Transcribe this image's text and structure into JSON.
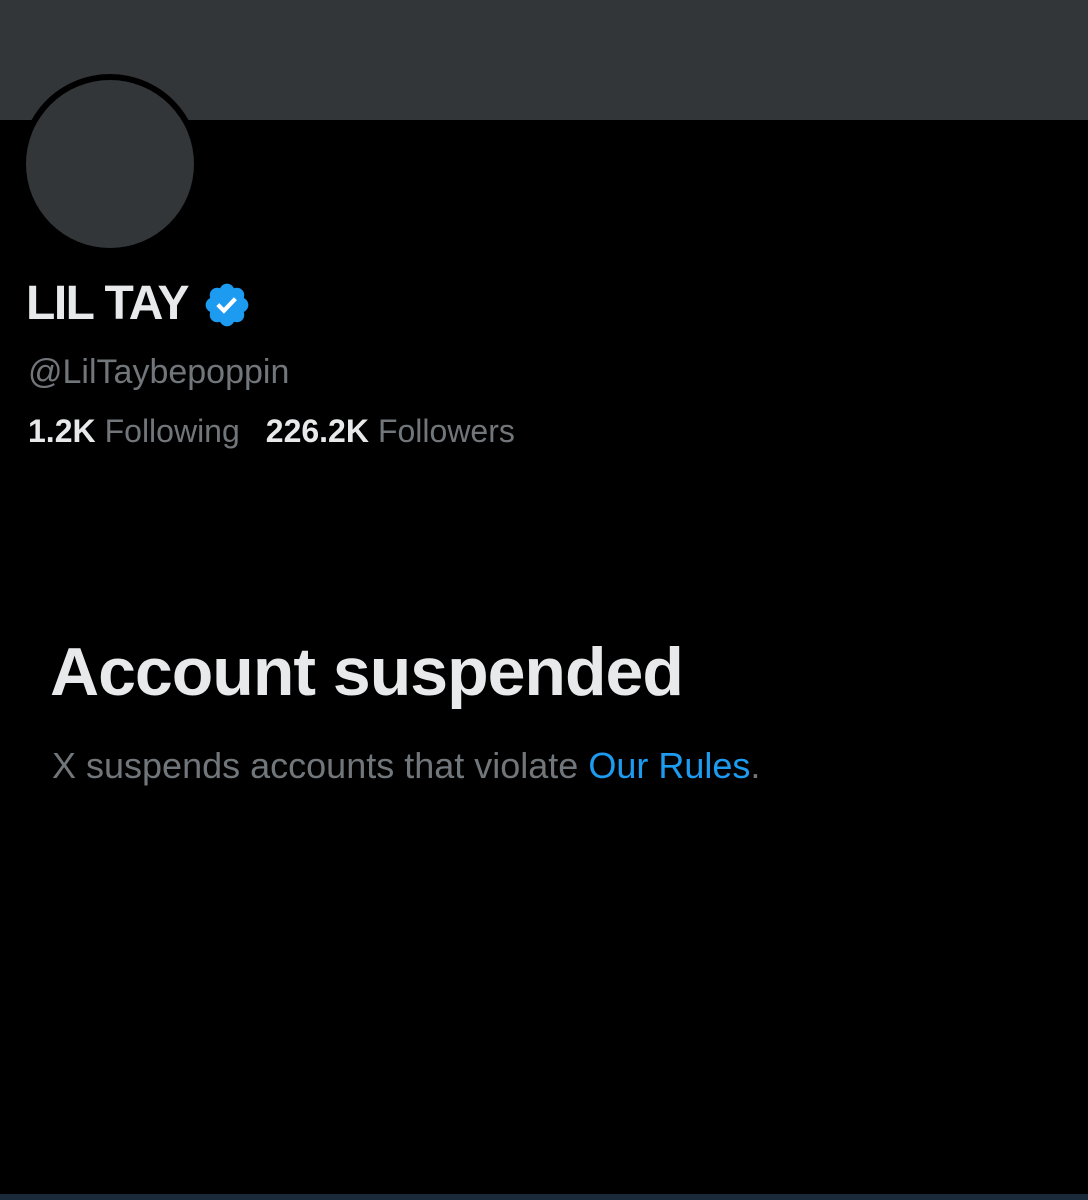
{
  "profile": {
    "display_name": "LIL TAY",
    "handle": "@LilTaybepoppin",
    "verified": true,
    "verified_icon": "verified-badge-icon",
    "verified_color": "#1d9bf0"
  },
  "stats": {
    "following_count": "1.2K",
    "following_label": "Following",
    "followers_count": "226.2K",
    "followers_label": "Followers"
  },
  "suspension": {
    "title": "Account suspended",
    "message": "X suspends accounts that violate ",
    "link_text": "Our Rules",
    "trailing": "."
  },
  "colors": {
    "background": "#000000",
    "banner": "#333639",
    "primary_text": "#e7e9ea",
    "secondary_text": "#71767b",
    "link": "#1d9bf0"
  }
}
